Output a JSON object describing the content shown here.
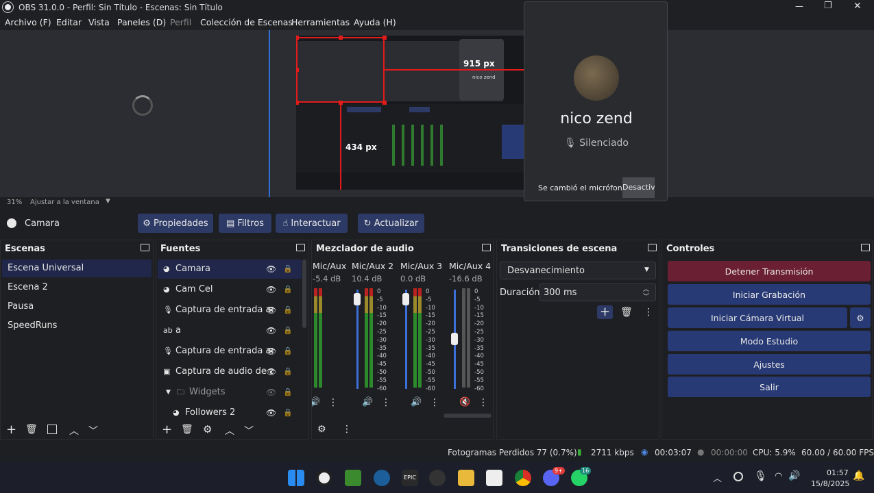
{
  "window": {
    "title": "OBS 31.0.0 - Perfil: Sin Título - Escenas: Sin Título",
    "min": "—",
    "max": "❐",
    "close": "✕"
  },
  "menu": [
    "Archivo (F)",
    "Editar",
    "Vista",
    "Paneles (D)",
    "Perfil",
    "Colección de Escenas",
    "Herramientas",
    "Ayuda (H)"
  ],
  "preview": {
    "zoom": "31%",
    "fit": "Ajustar a la ventana",
    "width_label": "915 px",
    "height_label": "434 px",
    "mini_name": "nico zend"
  },
  "notification": {
    "name": "nico zend",
    "status": "Silenciado",
    "message": "Se cambió el micrófono",
    "action": "Desactiva"
  },
  "source_toolbar": {
    "source": "Camara",
    "props": "Propiedades",
    "filters": "Filtros",
    "interact": "Interactuar",
    "refresh": "Actualizar"
  },
  "scenes": {
    "title": "Escenas",
    "items": [
      "Escena Universal",
      "Escena 2",
      "Pausa",
      "SpeedRuns"
    ]
  },
  "sources": {
    "title": "Fuentes",
    "items": [
      {
        "label": "Camara",
        "icon": "camera-icon"
      },
      {
        "label": "Cam Cel",
        "icon": "camera-icon"
      },
      {
        "label": "Captura de entrada audio",
        "icon": "mic-icon"
      },
      {
        "label": "a",
        "icon": "text-icon"
      },
      {
        "label": "Captura de entrada audio",
        "icon": "mic-icon"
      },
      {
        "label": "Captura de audio de ap",
        "icon": "app-audio-icon"
      },
      {
        "label": "Widgets",
        "icon": "folder-icon"
      },
      {
        "label": "Followers 2",
        "icon": "browser-icon"
      }
    ]
  },
  "mixer": {
    "title": "Mezclador de audio",
    "channels": [
      {
        "name": "Mic/Aux",
        "db": "-5.4 dB",
        "level": 0.25
      },
      {
        "name": "Mic/Aux 2",
        "db": "10.4 dB",
        "level": 0.05
      },
      {
        "name": "Mic/Aux 3",
        "db": "0.0 dB",
        "level": 0.05
      },
      {
        "name": "Mic/Aux 4",
        "db": "-16.6 dB",
        "level": 0.45
      }
    ],
    "ticks": [
      "0",
      "-5",
      "-10",
      "-15",
      "-20",
      "-25",
      "-30",
      "-35",
      "-40",
      "-45",
      "-50",
      "-55",
      "-60"
    ]
  },
  "transitions": {
    "title": "Transiciones de escena",
    "selected": "Desvanecimiento",
    "duration_label": "Duración",
    "duration_value": "300 ms"
  },
  "controls": {
    "title": "Controles",
    "buttons": [
      "Detener Transmisión",
      "Iniciar Grabación",
      "Iniciar Cámara Virtual",
      "Modo Estudio",
      "Ajustes",
      "Salir"
    ]
  },
  "status": {
    "frames": "Fotogramas Perdidos 77 (0.7%)",
    "bitrate": "2711 kbps",
    "stream_time": "00:03:07",
    "rec_time": "00:00:00",
    "cpu": "CPU: 5.9%",
    "fps": "60.00 / 60.00 FPS"
  },
  "taskbar": {
    "time": "01:57",
    "date": "15/8/2025",
    "discord_badge": "9+",
    "whatsapp_badge": "16",
    "epic": "EPIC"
  },
  "colors": {
    "accent": "#2d3a66",
    "stop": "#6b1f33",
    "ctrl": "#283a75"
  }
}
